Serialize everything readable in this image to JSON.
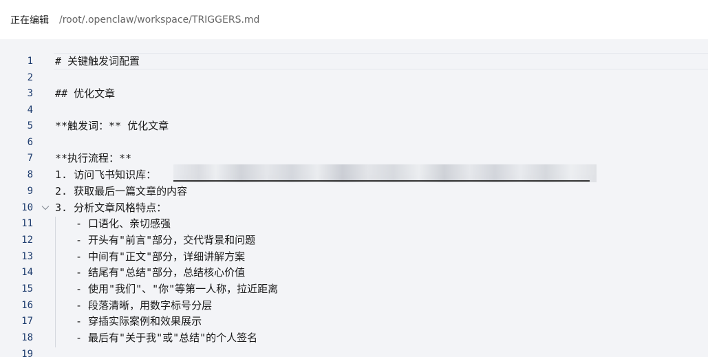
{
  "header": {
    "status": "正在编辑",
    "path": "/root/.openclaw/workspace/TRIGGERS.md"
  },
  "editor": {
    "lines": [
      {
        "n": "1",
        "text": "# 关键触发词配置"
      },
      {
        "n": "2",
        "text": ""
      },
      {
        "n": "3",
        "text": "## 优化文章"
      },
      {
        "n": "4",
        "text": ""
      },
      {
        "n": "5",
        "text": "**触发词：** 优化文章"
      },
      {
        "n": "6",
        "text": ""
      },
      {
        "n": "7",
        "text": "**执行流程：**"
      },
      {
        "n": "8",
        "text": "1. 访问飞书知识库："
      },
      {
        "n": "9",
        "text": "2. 获取最后一篇文章的内容"
      },
      {
        "n": "10",
        "text": "3. 分析文章风格特点："
      },
      {
        "n": "11",
        "text": "- 口语化、亲切感强"
      },
      {
        "n": "12",
        "text": "- 开头有\"前言\"部分，交代背景和问题"
      },
      {
        "n": "13",
        "text": "- 中间有\"正文\"部分，详细讲解方案"
      },
      {
        "n": "14",
        "text": "- 结尾有\"总结\"部分，总结核心价值"
      },
      {
        "n": "15",
        "text": "- 使用\"我们\"、\"你\"等第一人称，拉近距离"
      },
      {
        "n": "16",
        "text": "- 段落清晰，用数字标号分层"
      },
      {
        "n": "17",
        "text": "- 穿插实际案例和效果展示"
      },
      {
        "n": "18",
        "text": "- 最后有\"关于我\"或\"总结\"的个人签名"
      },
      {
        "n": "19",
        "text": ""
      }
    ]
  }
}
